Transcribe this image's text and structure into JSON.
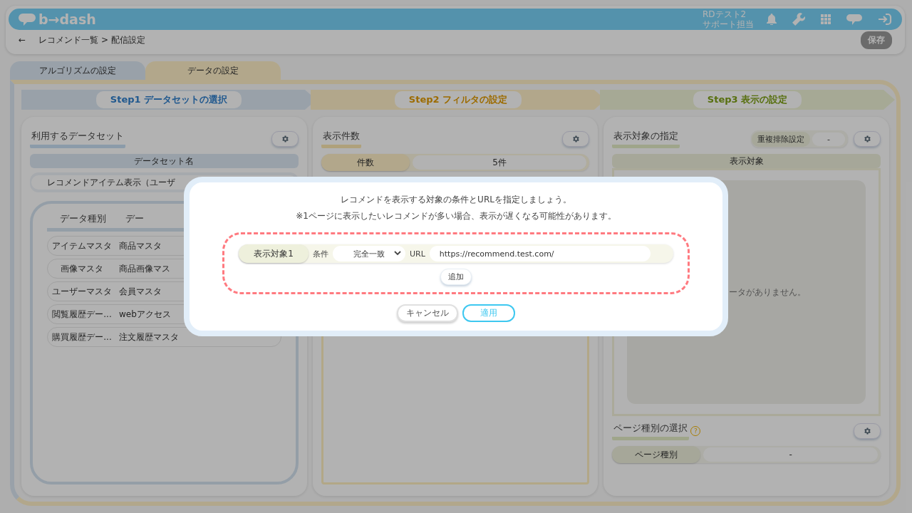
{
  "header": {
    "logo": "b→dash",
    "user_name": "RDテスト2",
    "user_role": "サポート担当"
  },
  "breadcrumb": {
    "back": "←",
    "path": "レコメンド一覧 > 配信設定"
  },
  "save_button": {
    "label": "保存",
    "disabled": true
  },
  "tabs": [
    {
      "label": "アルゴリズムの設定",
      "selected": false
    },
    {
      "label": "データの設定",
      "selected": true
    }
  ],
  "steps": [
    {
      "label": "Step1 データセットの選択"
    },
    {
      "label": "Step2 フィルタの設定"
    },
    {
      "label": "Step3 表示の設定"
    }
  ],
  "dataset_panel": {
    "title": "利用するデータセット",
    "header": "データセット名",
    "value": "レコメンドアイテム表示（ユーザ",
    "columns": [
      "データ種別",
      "デー"
    ],
    "rows": [
      {
        "type": "アイテムマスタ",
        "data": "商品マスタ"
      },
      {
        "type": "画像マスタ",
        "data": "商品画像マス"
      },
      {
        "type": "ユーザーマスタ",
        "data": "会員マスタ"
      },
      {
        "type": "閲覧履歴デー...",
        "data": "webアクセス"
      },
      {
        "type": "購買履歴デー...",
        "data": "注文履歴マスタ"
      }
    ]
  },
  "count_panel": {
    "title": "表示件数",
    "label": "件数",
    "value": "5件"
  },
  "target_panel": {
    "title": "表示対象の指定",
    "dedupe_label": "重複排除設定",
    "dedupe_value": "-",
    "header": "表示対象",
    "empty": "ータがありません。",
    "page_type_title": "ページ種別の選択",
    "help": "?",
    "page_type_label": "ページ種別",
    "page_type_value": "-"
  },
  "modal": {
    "title": "レコメンドを表示する対象の条件とURLを指定しましょう。",
    "note": "※1ページに表示したいレコメンドが多い場合、表示が遅くなる可能性があります。",
    "targets": [
      {
        "label": "表示対象1",
        "condition_label": "条件",
        "condition": "完全一致",
        "url_label": "URL",
        "url": "https://recommend.test.com/"
      }
    ],
    "add_button": "追加",
    "cancel_button": "キャンセル",
    "apply_button": "適用"
  }
}
